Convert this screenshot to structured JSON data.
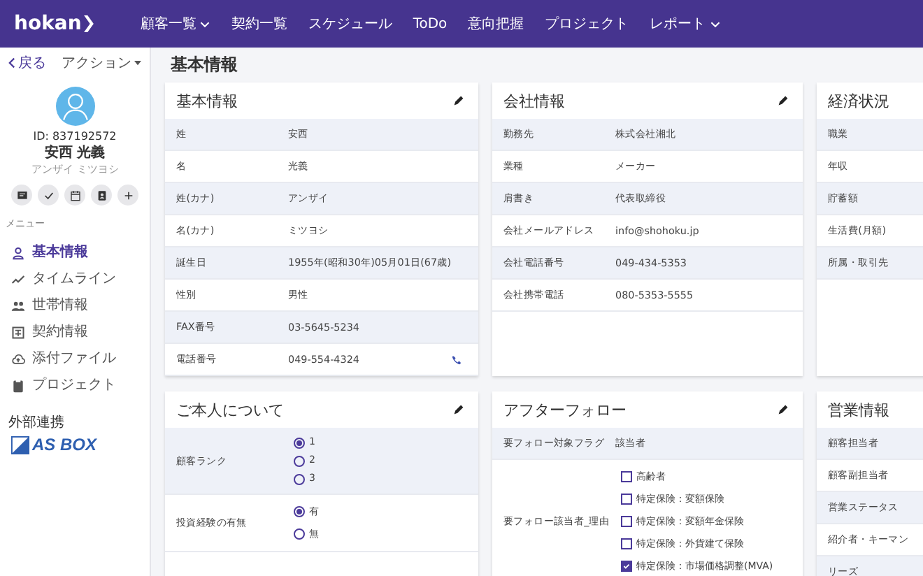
{
  "nav": {
    "logo": "hokan",
    "items": [
      {
        "label": "顧客一覧",
        "dropdown": true
      },
      {
        "label": "契約一覧",
        "dropdown": false
      },
      {
        "label": "スケジュール",
        "dropdown": false
      },
      {
        "label": "ToDo",
        "dropdown": false
      },
      {
        "label": "意向把握",
        "dropdown": false
      },
      {
        "label": "プロジェクト",
        "dropdown": false
      },
      {
        "label": "レポート",
        "dropdown": true
      }
    ]
  },
  "sidebar": {
    "back": "戻る",
    "actions": "アクション",
    "customer": {
      "id": "ID: 837192572",
      "name": "安西 光義",
      "kana": "アンザイ ミツヨシ"
    },
    "quick_actions": [
      {
        "kind": "message"
      },
      {
        "kind": "check"
      },
      {
        "kind": "calendar"
      },
      {
        "kind": "contact"
      },
      {
        "kind": "add"
      }
    ],
    "menu_heading": "メニュー",
    "menu": [
      {
        "label": "基本情報",
        "kind": "person",
        "selected": true
      },
      {
        "label": "タイムライン",
        "kind": "trend",
        "selected": false
      },
      {
        "label": "世帯情報",
        "kind": "people",
        "selected": false
      },
      {
        "label": "契約情報",
        "kind": "contract",
        "selected": false
      },
      {
        "label": "添付ファイル",
        "kind": "cloud",
        "selected": false
      },
      {
        "label": "プロジェクト",
        "kind": "clipboard",
        "selected": false
      }
    ],
    "integrations_heading": "外部連携",
    "integration_logo": "AS BOX"
  },
  "page_title": "基本情報",
  "cards": [
    {
      "title": "基本情報",
      "editable": true,
      "rows": [
        {
          "kind": "text",
          "label": "姓",
          "value": "安西"
        },
        {
          "kind": "text",
          "label": "名",
          "value": "光義"
        },
        {
          "kind": "text",
          "label": "姓(カナ)",
          "value": "アンザイ"
        },
        {
          "kind": "text",
          "label": "名(カナ)",
          "value": "ミツヨシ"
        },
        {
          "kind": "text",
          "label": "誕生日",
          "value": "1955年(昭和30年)05月01日(67歳)"
        },
        {
          "kind": "text",
          "label": "性別",
          "value": "男性"
        },
        {
          "kind": "text",
          "label": "FAX番号",
          "value": "03-5645-5234"
        },
        {
          "kind": "phone",
          "label": "電話番号",
          "value": "049-554-4324"
        }
      ]
    },
    {
      "title": "会社情報",
      "editable": true,
      "rows": [
        {
          "kind": "text",
          "label": "勤務先",
          "value": "株式会社湘北"
        },
        {
          "kind": "text",
          "label": "業種",
          "value": "メーカー"
        },
        {
          "kind": "text",
          "label": "肩書き",
          "value": "代表取締役"
        },
        {
          "kind": "text",
          "label": "会社メールアドレス",
          "value": "info@shohoku.jp"
        },
        {
          "kind": "text",
          "label": "会社電話番号",
          "value": "049-434-5353"
        },
        {
          "kind": "text",
          "label": "会社携帯電話",
          "value": "080-5353-5555"
        }
      ]
    },
    {
      "title": "経済状況",
      "rows": [
        {
          "kind": "text",
          "label": "職業"
        },
        {
          "kind": "text",
          "label": "年収"
        },
        {
          "kind": "text",
          "label": "貯蓄額"
        },
        {
          "kind": "text",
          "label": "生活費(月額)"
        },
        {
          "kind": "text",
          "label": "所属・取引先"
        }
      ]
    },
    {
      "title": "ご本人について",
      "editable": true,
      "rows": [
        {
          "kind": "radio",
          "label": "顧客ランク",
          "options": [
            {
              "label": "1",
              "selected": true
            },
            {
              "label": "2",
              "selected": false
            },
            {
              "label": "3",
              "selected": false
            }
          ]
        },
        {
          "kind": "radio",
          "label": "投資経験の有無",
          "options": [
            {
              "label": "有",
              "selected": true
            },
            {
              "label": "無",
              "selected": false
            }
          ]
        }
      ]
    },
    {
      "title": "アフターフォロー",
      "editable": true,
      "rows": [
        {
          "kind": "text",
          "label": "要フォロー対象フラグ",
          "value": "該当者"
        },
        {
          "kind": "checkbox",
          "label": "要フォロー該当者_理由",
          "options": [
            {
              "label": "高齢者",
              "checked": false
            },
            {
              "label": "特定保険：変額保険",
              "checked": false
            },
            {
              "label": "特定保険：変額年金保険",
              "checked": false
            },
            {
              "label": "特定保険：外貨建て保険",
              "checked": false
            },
            {
              "label": "特定保険：市場価格調整(MVA)",
              "checked": true
            }
          ]
        }
      ]
    },
    {
      "title": "営業情報",
      "rows": [
        {
          "kind": "text",
          "label": "顧客担当者"
        },
        {
          "kind": "text",
          "label": "顧客副担当者"
        },
        {
          "kind": "text",
          "label": "営業ステータス"
        },
        {
          "kind": "text",
          "label": "紹介者・キーマン"
        },
        {
          "kind": "text",
          "label": "リーズ"
        }
      ]
    }
  ]
}
